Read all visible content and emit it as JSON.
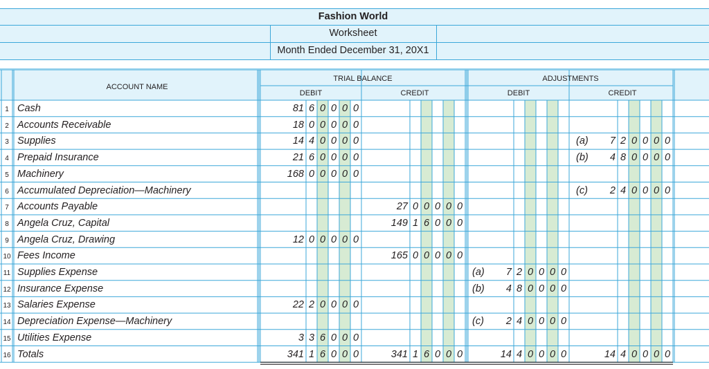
{
  "header": {
    "company": "Fashion World",
    "title": "Worksheet",
    "period": "Month Ended December 31, 20X1"
  },
  "columns": {
    "account_name": "ACCOUNT NAME",
    "trial_balance": "TRIAL BALANCE",
    "adjustments": "ADJUSTMENTS",
    "debit": "DEBIT",
    "credit": "CREDIT"
  },
  "rows": [
    {
      "line": "1",
      "account": "Cash",
      "tb_debit": "81600.00",
      "tb_credit": "",
      "adj_debit": "",
      "adj_debit_ref": "",
      "adj_credit": "",
      "adj_credit_ref": ""
    },
    {
      "line": "2",
      "account": "Accounts Receivable",
      "tb_debit": "18000.00",
      "tb_credit": "",
      "adj_debit": "",
      "adj_debit_ref": "",
      "adj_credit": "",
      "adj_credit_ref": ""
    },
    {
      "line": "3",
      "account": "Supplies",
      "tb_debit": "14400.00",
      "tb_credit": "",
      "adj_debit": "",
      "adj_debit_ref": "",
      "adj_credit": "7200.00",
      "adj_credit_ref": "(a)"
    },
    {
      "line": "4",
      "account": "Prepaid Insurance",
      "tb_debit": "21600.00",
      "tb_credit": "",
      "adj_debit": "",
      "adj_debit_ref": "",
      "adj_credit": "4800.00",
      "adj_credit_ref": "(b)"
    },
    {
      "line": "5",
      "account": "Machinery",
      "tb_debit": "168000.00",
      "tb_credit": "",
      "adj_debit": "",
      "adj_debit_ref": "",
      "adj_credit": "",
      "adj_credit_ref": ""
    },
    {
      "line": "6",
      "account": "Accumulated Depreciation—Machinery",
      "tb_debit": "",
      "tb_credit": "",
      "adj_debit": "",
      "adj_debit_ref": "",
      "adj_credit": "2400.00",
      "adj_credit_ref": "(c)"
    },
    {
      "line": "7",
      "account": "Accounts Payable",
      "tb_debit": "",
      "tb_credit": "27000.00",
      "adj_debit": "",
      "adj_debit_ref": "",
      "adj_credit": "",
      "adj_credit_ref": ""
    },
    {
      "line": "8",
      "account": "Angela Cruz, Capital",
      "tb_debit": "",
      "tb_credit": "149160.00",
      "adj_debit": "",
      "adj_debit_ref": "",
      "adj_credit": "",
      "adj_credit_ref": ""
    },
    {
      "line": "9",
      "account": "Angela Cruz, Drawing",
      "tb_debit": "12000.00",
      "tb_credit": "",
      "adj_debit": "",
      "adj_debit_ref": "",
      "adj_credit": "",
      "adj_credit_ref": ""
    },
    {
      "line": "10",
      "account": "Fees Income",
      "tb_debit": "",
      "tb_credit": "165000.00",
      "adj_debit": "",
      "adj_debit_ref": "",
      "adj_credit": "",
      "adj_credit_ref": ""
    },
    {
      "line": "11",
      "account": "Supplies Expense",
      "tb_debit": "",
      "tb_credit": "",
      "adj_debit": "7200.00",
      "adj_debit_ref": "(a)",
      "adj_credit": "",
      "adj_credit_ref": ""
    },
    {
      "line": "12",
      "account": "Insurance Expense",
      "tb_debit": "",
      "tb_credit": "",
      "adj_debit": "4800.00",
      "adj_debit_ref": "(b)",
      "adj_credit": "",
      "adj_credit_ref": ""
    },
    {
      "line": "13",
      "account": "Salaries Expense",
      "tb_debit": "22200.00",
      "tb_credit": "",
      "adj_debit": "",
      "adj_debit_ref": "",
      "adj_credit": "",
      "adj_credit_ref": ""
    },
    {
      "line": "14",
      "account": "Depreciation Expense—Machinery",
      "tb_debit": "",
      "tb_credit": "",
      "adj_debit": "2400.00",
      "adj_debit_ref": "(c)",
      "adj_credit": "",
      "adj_credit_ref": ""
    },
    {
      "line": "15",
      "account": "Utilities Expense",
      "tb_debit": "3360.00",
      "tb_credit": "",
      "adj_debit": "",
      "adj_debit_ref": "",
      "adj_credit": "",
      "adj_credit_ref": ""
    },
    {
      "line": "16",
      "account": "Totals",
      "tb_debit": "341160.00",
      "tb_credit": "341160.00",
      "adj_debit": "14400.00",
      "adj_debit_ref": "",
      "adj_credit": "14400.00",
      "adj_credit_ref": ""
    }
  ],
  "colors": {
    "grid_line": "#3ba7d9",
    "header_fill": "#e1f3fb",
    "shaded_digit_column": "#d7ebd3",
    "rule_line": "#231f20"
  }
}
